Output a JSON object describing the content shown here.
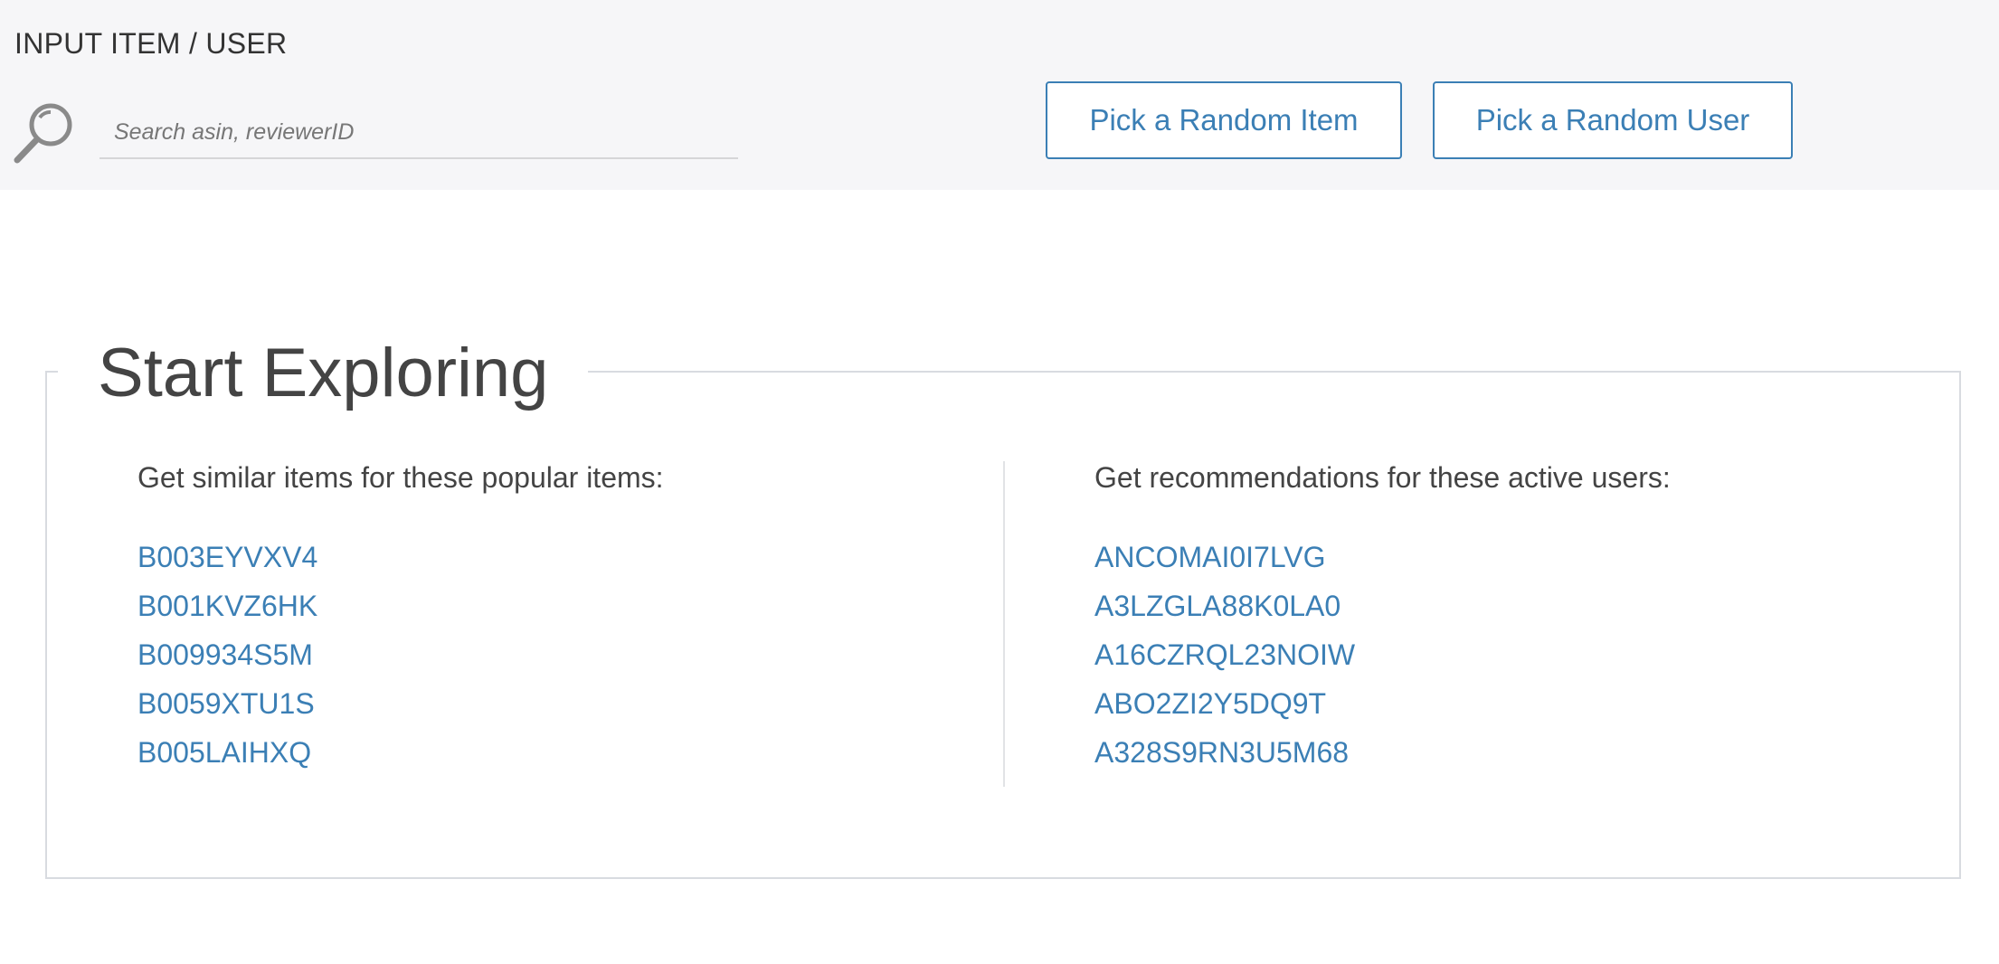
{
  "header": {
    "title": "INPUT ITEM / USER",
    "search_placeholder": "Search asin, reviewerID",
    "search_value": "",
    "random_item_label": "Pick a Random Item",
    "random_user_label": "Pick a Random User"
  },
  "explore": {
    "title": "Start Exploring",
    "items_heading": "Get similar items for these popular items:",
    "items": [
      "B003EYVXV4",
      "B001KVZ6HK",
      "B009934S5M",
      "B0059XTU1S",
      "B005LAIHXQ"
    ],
    "users_heading": "Get recommendations for these active users:",
    "users": [
      "ANCOMAI0I7LVG",
      "A3LZGLA88K0LA0",
      "A16CZRQL23NOIW",
      "ABO2ZI2Y5DQ9T",
      "A328S9RN3U5M68"
    ]
  },
  "colors": {
    "header_bg": "#f6f6f8",
    "accent": "#3b7fb5",
    "text": "#444444",
    "border": "#d8dbe0"
  },
  "icons": {
    "search": "magnifier-icon"
  }
}
